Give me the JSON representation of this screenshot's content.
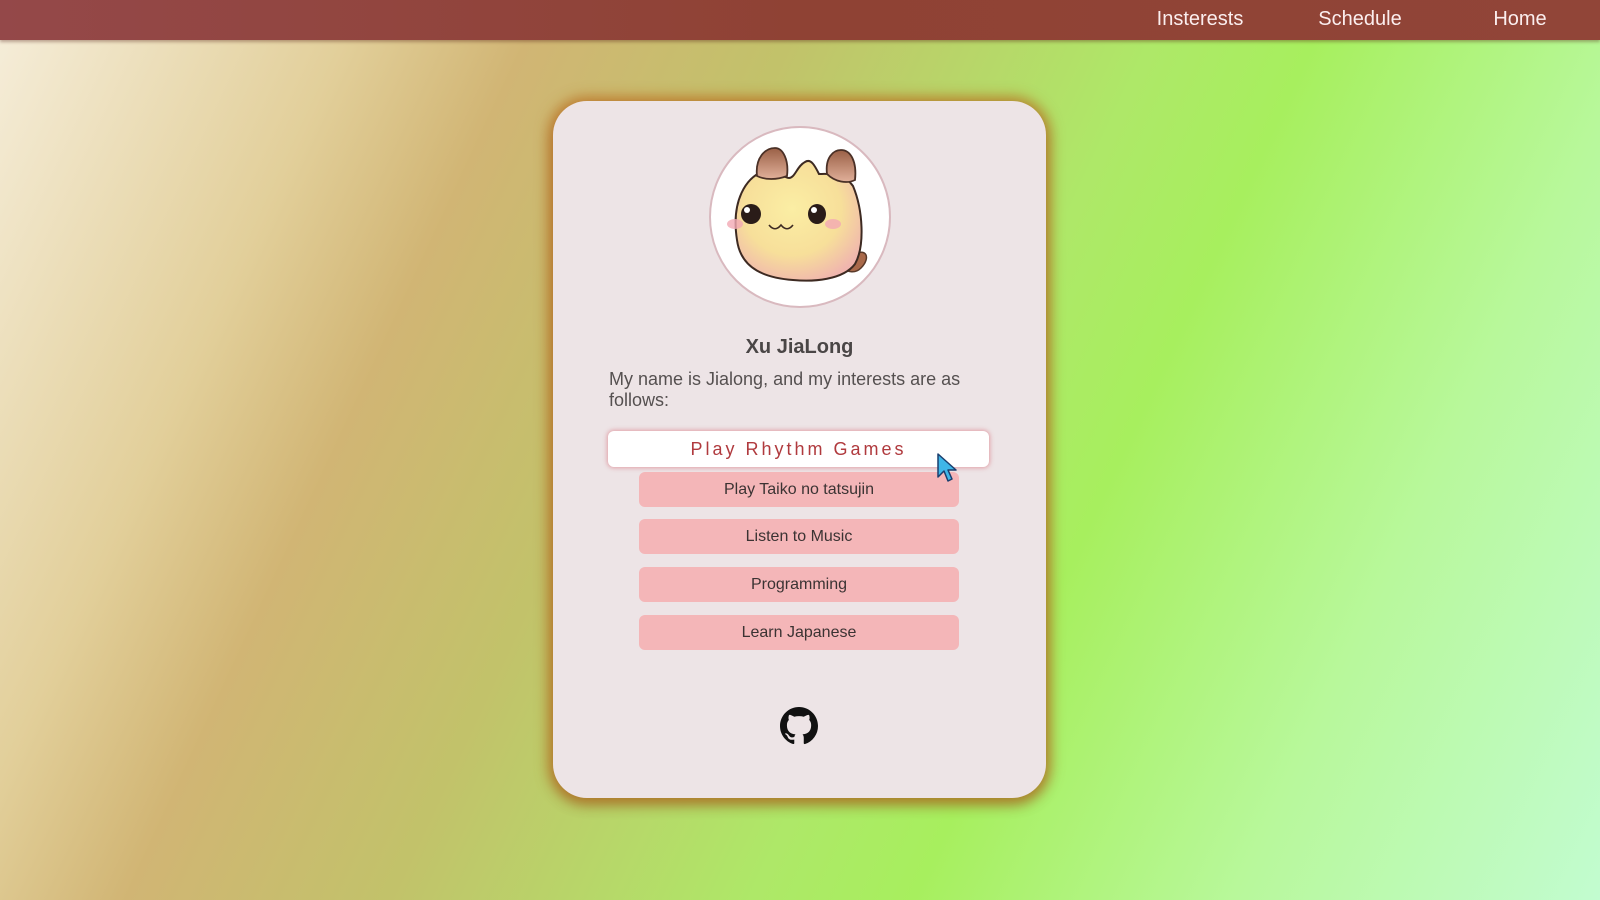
{
  "nav": {
    "links": [
      {
        "label": "Insterests"
      },
      {
        "label": "Schedule"
      },
      {
        "label": "Home"
      }
    ]
  },
  "profile": {
    "name": "Xu JiaLong",
    "intro": "My name is Jialong, and my interests are as follows:",
    "avatar_icon": "cat-mascot-avatar"
  },
  "interests": {
    "primary": "Play Rhythm Games",
    "items": [
      {
        "label": "Play Taiko no tatsujin"
      },
      {
        "label": "Listen to Music"
      },
      {
        "label": "Programming"
      },
      {
        "label": "Learn Japanese"
      }
    ]
  },
  "footer": {
    "icon": "github-icon"
  },
  "colors": {
    "topbar": "#8f4234",
    "card": "#ede4e6",
    "primary_button_text": "#b03a3e",
    "item_button": "#f4b6b8",
    "card_glow": "#be6e1e"
  }
}
